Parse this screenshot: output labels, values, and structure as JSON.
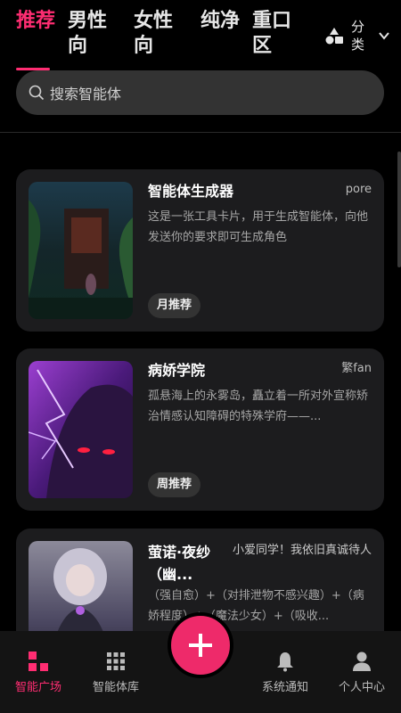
{
  "tabs": [
    {
      "label": "推荐",
      "active": true
    },
    {
      "label": "男性向",
      "active": false
    },
    {
      "label": "女性向",
      "active": false
    },
    {
      "label": "纯净",
      "active": false
    },
    {
      "label": "重口区",
      "active": false
    }
  ],
  "category": {
    "label": "分类",
    "icon": "shapes-icon"
  },
  "search": {
    "placeholder": "搜索智能体"
  },
  "cards": [
    {
      "title": "智能体生成器",
      "author": "pore",
      "description": "这是一张工具卡片，用于生成智能体，向他发送你的要求即可生成角色",
      "badge": "月推荐"
    },
    {
      "title": "病娇学院",
      "author": "繁fan",
      "description": "孤悬海上的永雾岛，矗立着一所对外宣称矫治情感认知障碍的特殊学府——...",
      "badge": "周推荐"
    },
    {
      "title": "萤诺·夜纱（幽...",
      "author": "小爱同学！我依旧真诚待人",
      "description": "（强自愈）+（对排泄物不感兴趣）+（病娇程度）+（魔法少女）+（吸收...",
      "badge": ""
    }
  ],
  "bottom_nav": [
    {
      "label": "智能广场",
      "icon": "grid-four-icon",
      "active": true
    },
    {
      "label": "智能体库",
      "icon": "grid-nine-icon",
      "active": false
    },
    {
      "label": "系统通知",
      "icon": "bell-icon",
      "active": false
    },
    {
      "label": "个人中心",
      "icon": "user-icon",
      "active": false
    }
  ],
  "colors": {
    "accent": "#ff2d72",
    "background": "#000000",
    "card": "#1c1c1e"
  }
}
